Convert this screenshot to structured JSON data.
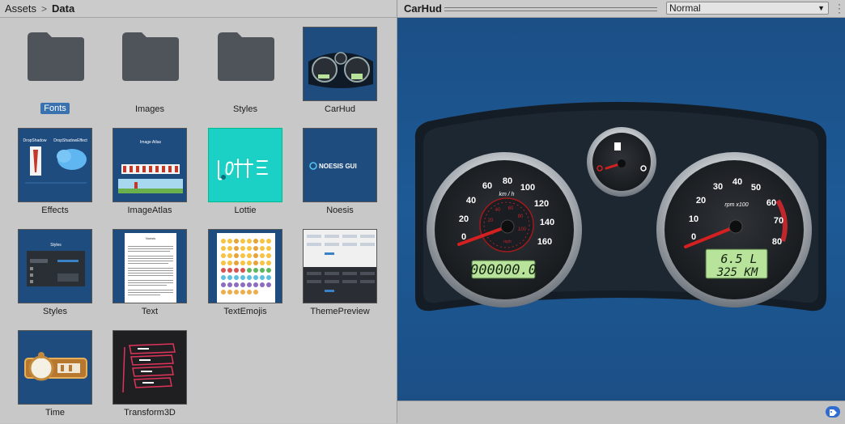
{
  "breadcrumb": {
    "root": "Assets",
    "current": "Data"
  },
  "assets": [
    {
      "name": "Fonts",
      "kind": "folder",
      "selected": true
    },
    {
      "name": "Images",
      "kind": "folder"
    },
    {
      "name": "Styles",
      "kind": "folder"
    },
    {
      "name": "CarHud",
      "kind": "scene"
    },
    {
      "name": "Effects",
      "kind": "scene"
    },
    {
      "name": "ImageAtlas",
      "kind": "scene"
    },
    {
      "name": "Lottie",
      "kind": "scene"
    },
    {
      "name": "Noesis",
      "kind": "scene"
    },
    {
      "name": "Styles",
      "kind": "scene"
    },
    {
      "name": "Text",
      "kind": "scene"
    },
    {
      "name": "TextEmojis",
      "kind": "scene"
    },
    {
      "name": "ThemePreview",
      "kind": "scene"
    },
    {
      "name": "Time",
      "kind": "scene"
    },
    {
      "name": "Transform3D",
      "kind": "scene"
    }
  ],
  "preview": {
    "title": "CarHud",
    "mode": "Normal",
    "speedo_unit": "km / h",
    "speedo_ticks": [
      "0",
      "20",
      "40",
      "60",
      "80",
      "100",
      "120",
      "140",
      "160"
    ],
    "inner_ticks": [
      "0",
      "20",
      "40",
      "60",
      "80",
      "100"
    ],
    "inner_unit": "mph",
    "rpm_unit": "rpm x100",
    "rpm_ticks": [
      "0",
      "10",
      "20",
      "30",
      "40",
      "50",
      "60",
      "70",
      "80"
    ],
    "odometer": "000000.0",
    "fuel_reading": "6.5 L",
    "range_reading": "325 KM"
  },
  "thumb_texts": {
    "effects_left": "DropShadow",
    "effects_right": "DropShadowEffect",
    "imageatlas": "Image Atlas",
    "noesis": "NOESIS GUI",
    "styles_title": "Styles",
    "text_title": "Noesis"
  },
  "colors": {
    "selection": "#3a72b0",
    "hud_bg": "#1c5290",
    "lcd": "#b8e39a",
    "needle": "#d42020"
  }
}
